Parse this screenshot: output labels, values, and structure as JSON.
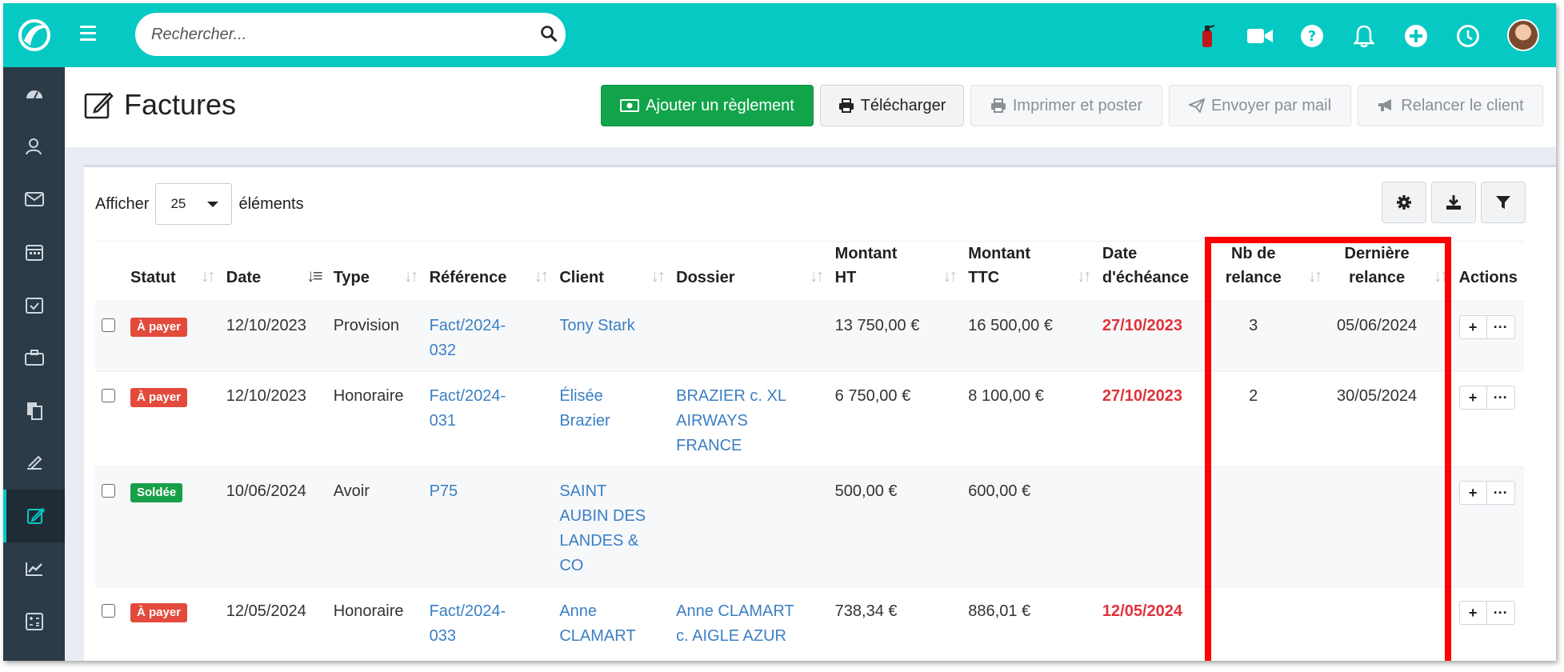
{
  "search": {
    "placeholder": "Rechercher..."
  },
  "topbar_icons": [
    "fire-extinguisher-icon",
    "video-camera-icon",
    "help-icon",
    "bell-icon",
    "plus-circle-icon",
    "clock-icon"
  ],
  "sidebar": {
    "items": [
      "dashboard-icon",
      "contacts-icon",
      "mail-icon",
      "calendar-icon",
      "tasks-icon",
      "briefcase-icon",
      "documents-icon",
      "signature-icon",
      "invoices-icon",
      "chart-icon",
      "calculator-icon"
    ],
    "active": "invoices-icon"
  },
  "page": {
    "title": "Factures"
  },
  "toolbar": {
    "add_payment": "Ajouter un règlement",
    "download": "Télécharger",
    "print_post": "Imprimer et poster",
    "send_mail": "Envoyer par mail",
    "remind_client": "Relancer le client"
  },
  "length": {
    "prefix": "Afficher",
    "value": "25",
    "suffix": "éléments"
  },
  "table": {
    "headers": {
      "statut": "Statut",
      "date": "Date",
      "type": "Type",
      "reference": "Référence",
      "client": "Client",
      "dossier": "Dossier",
      "montant_ht_1": "Montant",
      "montant_ht_2": "HT",
      "montant_ttc_1": "Montant",
      "montant_ttc_2": "TTC",
      "echeance_1": "Date",
      "echeance_2": "d'échéance",
      "nb_relance_1": "Nb de",
      "nb_relance_2": "relance",
      "derniere_1": "Dernière",
      "derniere_2": "relance",
      "actions": "Actions"
    },
    "rows": [
      {
        "statut": "À payer",
        "date": "12/10/2023",
        "type": "Provision",
        "ref1": "Fact/2024-",
        "ref2": "032",
        "client1": "Tony Stark",
        "client2": "",
        "client3": "",
        "client4": "",
        "dossier1": "",
        "dossier2": "",
        "dossier3": "",
        "ht": "13 750,00 €",
        "ttc": "16 500,00 €",
        "echeance": "27/10/2023",
        "nb": "3",
        "derniere": "05/06/2024"
      },
      {
        "statut": "À payer",
        "date": "12/10/2023",
        "type": "Honoraire",
        "ref1": "Fact/2024-",
        "ref2": "031",
        "client1": "Élisée",
        "client2": "Brazier",
        "client3": "",
        "client4": "",
        "dossier1": "BRAZIER c. XL",
        "dossier2": "AIRWAYS",
        "dossier3": "FRANCE",
        "ht": "6 750,00 €",
        "ttc": "8 100,00 €",
        "echeance": "27/10/2023",
        "nb": "2",
        "derniere": "30/05/2024"
      },
      {
        "statut": "Soldée",
        "date": "10/06/2024",
        "type": "Avoir",
        "ref1": "P75",
        "ref2": "",
        "client1": "SAINT",
        "client2": "AUBIN DES",
        "client3": "LANDES &",
        "client4": "CO",
        "dossier1": "",
        "dossier2": "",
        "dossier3": "",
        "ht": "500,00 €",
        "ttc": "600,00 €",
        "echeance": "",
        "nb": "",
        "derniere": ""
      },
      {
        "statut": "À payer",
        "date": "12/05/2024",
        "type": "Honoraire",
        "ref1": "Fact/2024-",
        "ref2": "033",
        "client1": "Anne",
        "client2": "CLAMART",
        "client3": "",
        "client4": "",
        "dossier1": "Anne CLAMART",
        "dossier2": "c. AIGLE AZUR",
        "dossier3": "",
        "ht": "738,34 €",
        "ttc": "886,01 €",
        "echeance": "12/05/2024",
        "nb": "",
        "derniere": ""
      }
    ],
    "action_add": "+",
    "action_more": "···"
  },
  "colors": {
    "teal": "#06c9c3",
    "sidebar": "#2b3b48",
    "green": "#11a44b",
    "red_badge": "#e34a3b",
    "green_badge": "#18a048",
    "link": "#3b7fc4",
    "due_red": "#e0333a",
    "highlight": "#ff0000"
  }
}
